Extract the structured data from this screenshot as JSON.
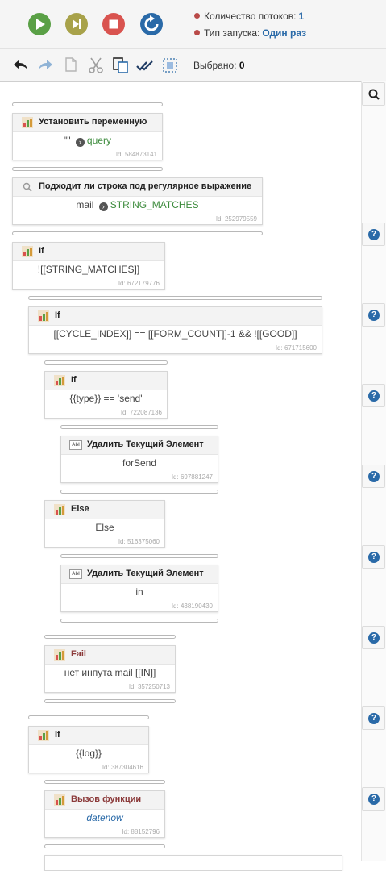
{
  "status": {
    "threads_label": "Количество потоков:",
    "threads_value": "1",
    "launch_label": "Тип запуска:",
    "launch_value": "Один раз"
  },
  "toolbar": {
    "selected_label": "Выбрано:",
    "selected_value": "0"
  },
  "colors": {
    "play": "#5aa046",
    "pause": "#a8a24a",
    "stop": "#d9534f",
    "restart": "#2a6aa8",
    "status_dot": "#b94a48",
    "accent_blue": "#2a6aa8"
  },
  "blocks": [
    {
      "title": "Установить переменную",
      "body_left": "\"\"",
      "body_right": "query",
      "id": "Id: 584873141",
      "icon": "variable-icon"
    },
    {
      "title": "Подходит ли строка под регулярное выражение",
      "body_left": "mail",
      "body_right": "STRING_MATCHES",
      "id": "Id: 252979559",
      "icon": "regex-search-icon"
    },
    {
      "title": "If",
      "body": "![[STRING_MATCHES]]",
      "id": "Id: 672179776",
      "icon": "condition-icon"
    },
    {
      "title": "If",
      "body": "[[CYCLE_INDEX]] == [[FORM_COUNT]]-1 && ![[GOOD]]",
      "id": "Id: 671715600",
      "icon": "condition-icon"
    },
    {
      "title": "If",
      "body": "{{type}} == 'send'",
      "id": "Id: 722087136",
      "icon": "condition-icon"
    },
    {
      "title": "Удалить Текущий Элемент",
      "body": "forSend",
      "id": "Id: 697881247",
      "icon": "abl-icon"
    },
    {
      "title": "Else",
      "body": "Else",
      "id": "Id: 516375060",
      "icon": "condition-icon"
    },
    {
      "title": "Удалить Текущий Элемент",
      "body": "in",
      "id": "Id: 438190430",
      "icon": "abl-icon"
    },
    {
      "title": "Fail",
      "body": "нет инпута mail [[IN]]",
      "id": "Id: 357250713",
      "icon": "fail-icon"
    },
    {
      "title": "If",
      "body": "{{log}}",
      "id": "Id: 387304616",
      "icon": "condition-icon"
    },
    {
      "title": "Вызов функции",
      "body": "datenow",
      "id": "Id: 88152796",
      "icon": "function-icon"
    }
  ],
  "side_help_label": "?"
}
